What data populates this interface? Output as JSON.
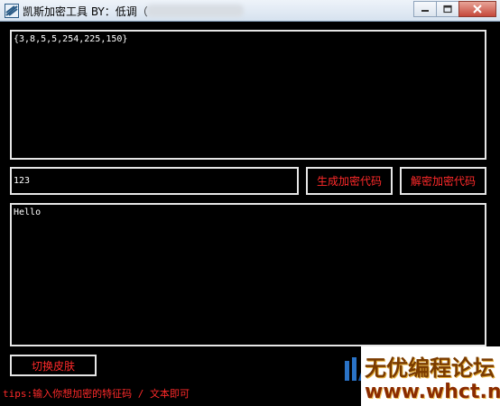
{
  "window": {
    "title": "凯斯加密工具  BY：低调（",
    "icon": "app-icon",
    "buttons": [
      "minimize-icon",
      "maximize-icon",
      "close-icon"
    ]
  },
  "top_output": {
    "value": "{3,8,5,5,254,225,150}"
  },
  "key_input": {
    "value": "123"
  },
  "buttons": {
    "generate": "生成加密代码",
    "decrypt": "解密加密代码",
    "switch_skin": "切换皮肤"
  },
  "bottom_text": {
    "value": "Hello"
  },
  "tips": "tips:输入你想加密的特征码 / 文本即可",
  "watermark": {
    "top": "无优编程论坛",
    "url": "www.whct.net"
  },
  "colors": {
    "accent_text": "#ff2a2a",
    "background": "#000000",
    "border": "#e6e6e6"
  }
}
